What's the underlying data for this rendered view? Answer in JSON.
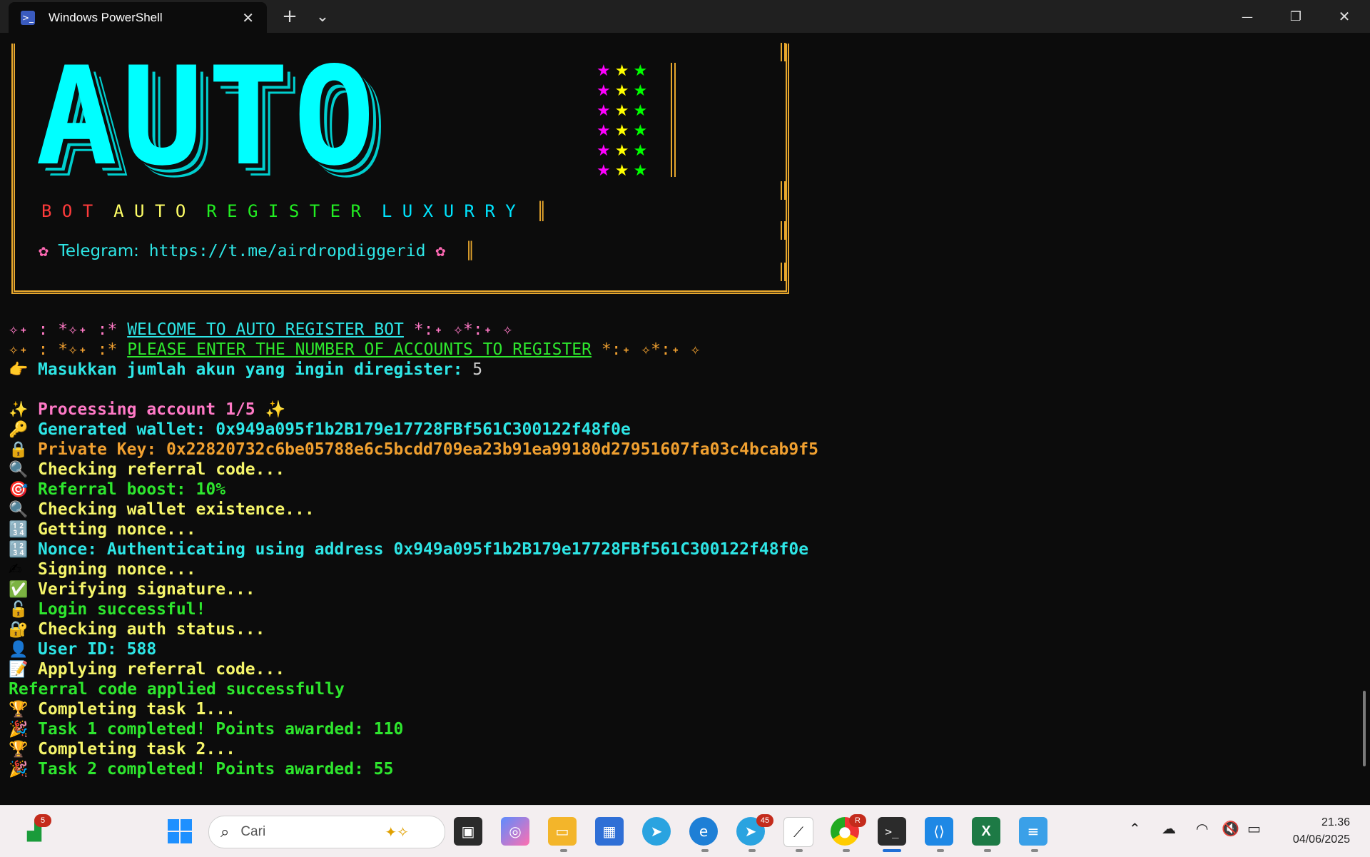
{
  "window": {
    "tab_title": "Windows PowerShell",
    "tab_icon": "powershell-icon",
    "close_tab": "✕",
    "new_tab": "+",
    "dropdown": "⌄",
    "minimize": "—",
    "restore": "❐",
    "close": "✕"
  },
  "banner": {
    "art_text": "AUTO",
    "stars_row": [
      "★",
      "★",
      "★"
    ],
    "star_colors": [
      "#ff00ff",
      "#ffff00",
      "#00ff00"
    ],
    "subtitle_words": [
      "B O T",
      "A U T O",
      "R E G I S T E R",
      "L U X U R R Y"
    ],
    "subtitle_colors": [
      "#ff3b3b",
      "#ffff66",
      "#22ee22",
      "#00e5ff"
    ],
    "bar_glyph": "║",
    "telegram_flower": "✿",
    "telegram_label": "Telegram:",
    "telegram_url": "https://t.me/airdropdiggerid"
  },
  "welcome": {
    "prefix": "✧˖ : *✧˖ :*",
    "title": "WELCOME TO AUTO REGISTER BOT",
    "suffix": "*:˖ ✧*:˖ ✧"
  },
  "prompt": {
    "prefix": "✧˖ : *✧˖ :*",
    "title": "PLEASE ENTER THE NUMBER OF ACCOUNTS TO REGISTER",
    "suffix": "*:˖ ✧*:˖ ✧",
    "question": "Masukkan jumlah akun yang ingin diregister:",
    "answer": "5"
  },
  "log": [
    {
      "icon": "✨",
      "text": "Processing account 1/5 ✨",
      "color": "#ff79c6"
    },
    {
      "icon": "🔑",
      "text": "Generated wallet: 0x949a095f1b2B179e17728FBf561C300122f48f0e",
      "color": "#2ee6e6"
    },
    {
      "icon": "🔒",
      "text": "Private Key: 0x22820732c6be05788e6c5bcdd709ea23b91ea99180d27951607fa03c4bcab9f5",
      "color": "#f0a030"
    },
    {
      "icon": "🔍",
      "text": "Checking referral code...",
      "color": "#f5f56a"
    },
    {
      "icon": "🎯",
      "text": "Referral boost: 10%",
      "color": "#2ee62e"
    },
    {
      "icon": "🔍",
      "text": "Checking wallet existence...",
      "color": "#f5f56a"
    },
    {
      "icon": "🔢",
      "text": "Getting nonce...",
      "color": "#f5f56a"
    },
    {
      "icon": "🔢",
      "text": "Nonce: Authenticating using address 0x949a095f1b2B179e17728FBf561C300122f48f0e",
      "color": "#2ee6e6"
    },
    {
      "icon": "✍",
      "text": "Signing nonce...",
      "color": "#f5f56a"
    },
    {
      "icon": "✅",
      "text": "Verifying signature...",
      "color": "#f5f56a"
    },
    {
      "icon": "🔓",
      "text": "Login successful!",
      "color": "#2ee62e"
    },
    {
      "icon": "🔐",
      "text": "Checking auth status...",
      "color": "#f5f56a"
    },
    {
      "icon": "👤",
      "text": "User ID: 588",
      "color": "#2ee6e6"
    },
    {
      "icon": "📝",
      "text": "Applying referral code...",
      "color": "#f5f56a"
    },
    {
      "icon": "",
      "text": "Referral code applied successfully",
      "color": "#2ee62e"
    },
    {
      "icon": "🏆",
      "text": "Completing task 1...",
      "color": "#f5f56a"
    },
    {
      "icon": "🎉",
      "text": "Task 1 completed! Points awarded: 110",
      "color": "#2ee62e"
    },
    {
      "icon": "🏆",
      "text": "Completing task 2...",
      "color": "#f5f56a"
    },
    {
      "icon": "🎉",
      "text": "Task 2 completed! Points awarded: 55",
      "color": "#2ee62e"
    }
  ],
  "taskbar": {
    "search_placeholder": "Cari",
    "widgets_badge": "5",
    "telegram_badge": "45",
    "chrome_badge": "R",
    "apps": [
      "start-icon",
      "task-view-icon",
      "copilot-icon",
      "file-explorer-icon",
      "store-icon",
      "telegram-icon",
      "edge-icon",
      "telegram-beta-icon",
      "app-icon",
      "chrome-icon",
      "terminal-icon",
      "vscode-icon",
      "excel-icon",
      "notepad-icon"
    ],
    "time": "21.36",
    "date": "04/06/2025"
  }
}
